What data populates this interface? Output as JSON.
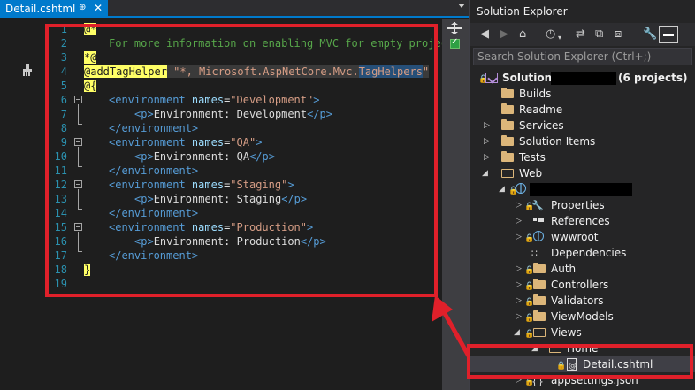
{
  "editor": {
    "tab_label": "Detail.cshtml",
    "tab_pin": "⊕",
    "tab_close": "✕",
    "line_numbers": [
      "1",
      "2",
      "3",
      "4",
      "5",
      "6",
      "7",
      "8",
      "9",
      "10",
      "11",
      "12",
      "13",
      "14",
      "15",
      "16",
      "17",
      "18",
      "19"
    ],
    "lines": {
      "l1_razor": "@*",
      "l2_comment": "For more information on enabling MVC for empty project",
      "l3_razor": "*@",
      "l4_directive": "@addTagHelper",
      "l4_str_a": " \"*, ",
      "l4_str_b": "Microsoft.AspNetCore.Mvc.",
      "l4_str_c": "TagHelpers",
      "l4_str_d": "\"",
      "l5_razor": "@{",
      "env_open": "<environment",
      "env_attr": " names",
      "eq": "=",
      "env_close_bracket": ">",
      "env_end": "</environment>",
      "p_open": "<p>",
      "p_close": "</p>",
      "dev_name": "\"Development\"",
      "dev_text": "Environment: Development",
      "qa_name": "\"QA\"",
      "qa_text": "Environment: QA",
      "stg_name": "\"Staging\"",
      "stg_text": "Environment: Staging",
      "prod_name": "\"Production\"",
      "prod_text": "Environment: Production",
      "l18_razor": "}"
    }
  },
  "solution_explorer": {
    "title": "Solution Explorer",
    "search_placeholder": "Search Solution Explorer (Ctrl+;)",
    "solution_label": "Solution",
    "solution_count": "(6 projects)",
    "items": [
      {
        "label": "Builds"
      },
      {
        "label": "Readme"
      },
      {
        "label": "Services"
      },
      {
        "label": "Solution Items"
      },
      {
        "label": "Tests"
      },
      {
        "label": "Web"
      },
      {
        "label": "Properties"
      },
      {
        "label": "References"
      },
      {
        "label": "wwwroot"
      },
      {
        "label": "Dependencies"
      },
      {
        "label": "Auth"
      },
      {
        "label": "Controllers"
      },
      {
        "label": "Validators"
      },
      {
        "label": "ViewModels"
      },
      {
        "label": "Views"
      },
      {
        "label": "Home"
      },
      {
        "label": "Detail.cshtml"
      },
      {
        "label": "appsettings.json"
      }
    ]
  },
  "colors": {
    "accent": "#007acc",
    "annotation_red": "#e0202a",
    "razor_highlight": "#ffff66"
  }
}
